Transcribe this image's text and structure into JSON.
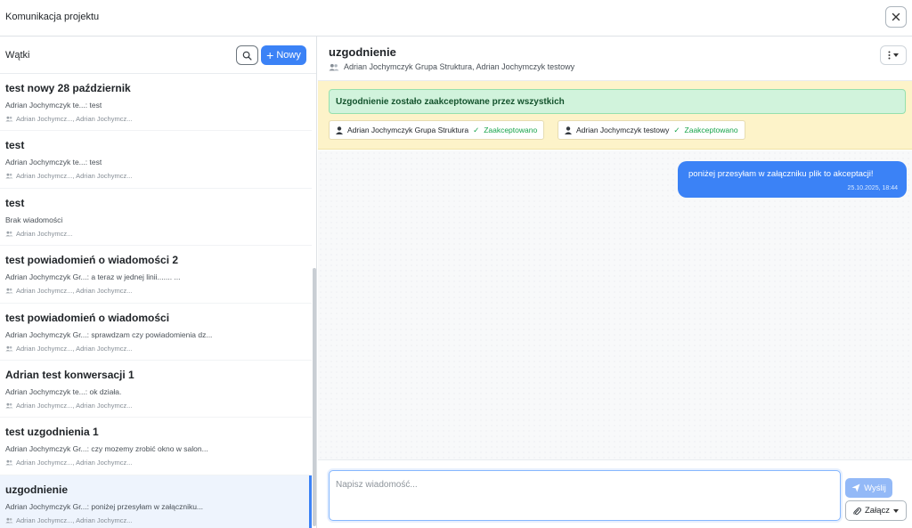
{
  "window": {
    "title": "Komunikacja projektu",
    "close_icon": "close-icon"
  },
  "sidebar": {
    "label": "Wątki",
    "new_label": "Nowy",
    "threads": [
      {
        "title": "test nowy 28 październik",
        "preview": "Adrian Jochymczyk te...: test",
        "members": "Adrian Jochymcz..., Adrian Jochymcz...",
        "active": false
      },
      {
        "title": "test",
        "preview": "Adrian Jochymczyk te...: test",
        "members": "Adrian Jochymcz..., Adrian Jochymcz...",
        "active": false
      },
      {
        "title": "test",
        "preview": "Brak wiadomości",
        "members": "Adrian Jochymcz...",
        "active": false
      },
      {
        "title": "test powiadomień o wiadomości 2",
        "preview": "Adrian Jochymczyk Gr...: a teraz w jednej linii....... ...",
        "members": "Adrian Jochymcz..., Adrian Jochymcz...",
        "active": false
      },
      {
        "title": "test powiadomień o wiadomości",
        "preview": "Adrian Jochymczyk Gr...: sprawdzam czy powiadomienia dz...",
        "members": "Adrian Jochymcz..., Adrian Jochymcz...",
        "active": false
      },
      {
        "title": "Adrian test konwersacji 1",
        "preview": "Adrian Jochymczyk te...: ok działa.",
        "members": "Adrian Jochymcz..., Adrian Jochymcz...",
        "active": false
      },
      {
        "title": "test uzgodnienia 1",
        "preview": "Adrian Jochymczyk Gr...: czy mozemy zrobić okno w salon...",
        "members": "Adrian Jochymcz..., Adrian Jochymcz...",
        "active": false
      },
      {
        "title": "uzgodnienie",
        "preview": "Adrian Jochymczyk Gr...: poniżej przesyłam w załączniku...",
        "members": "Adrian Jochymcz..., Adrian Jochymcz...",
        "active": true
      }
    ]
  },
  "chat": {
    "title": "uzgodnienie",
    "members": "Adrian Jochymczyk Grupa Struktura, Adrian Jochymczyk testowy",
    "approval_message": "Uzgodnienie zostało zaakceptowane przez wszystkich",
    "approvals": [
      {
        "name": "Adrian Jochymczyk Grupa Struktura",
        "status": "Zaakceptowano"
      },
      {
        "name": "Adrian Jochymczyk testowy",
        "status": "Zaakceptowano"
      }
    ],
    "messages": [
      {
        "text": "poniżej przesyłam w załączniku plik to akceptacji!",
        "time": "25.10.2025, 18:44"
      }
    ]
  },
  "composer": {
    "placeholder": "Napisz wiadomość...",
    "send_label": "Wyślij",
    "attach_label": "Załącz"
  },
  "colors": {
    "accent": "#3b82f6",
    "success": "#16a34a",
    "approval_bg": "#fdf3c9"
  }
}
